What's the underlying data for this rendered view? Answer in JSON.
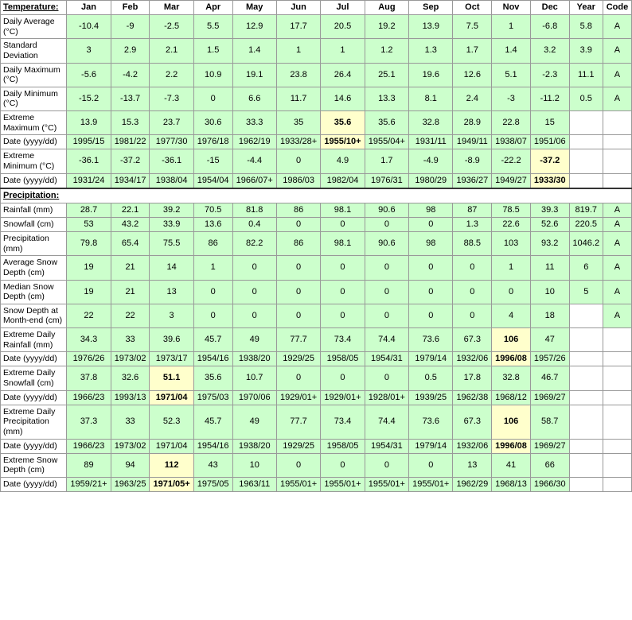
{
  "headers": {
    "label": "Temperature:",
    "months": [
      "Jan",
      "Feb",
      "Mar",
      "Apr",
      "May",
      "Jun",
      "Jul",
      "Aug",
      "Sep",
      "Oct",
      "Nov",
      "Dec",
      "Year",
      "Code"
    ]
  },
  "rows": [
    {
      "label": "Daily Average (°C)",
      "values": [
        "-10.4",
        "-9",
        "-2.5",
        "5.5",
        "12.9",
        "17.7",
        "20.5",
        "19.2",
        "13.9",
        "7.5",
        "1",
        "-6.8",
        "5.8",
        "A"
      ],
      "bg": [
        "green",
        "green",
        "green",
        "green",
        "green",
        "green",
        "green",
        "green",
        "green",
        "green",
        "green",
        "green",
        "green",
        "green"
      ]
    },
    {
      "label": "Standard Deviation",
      "values": [
        "3",
        "2.9",
        "2.1",
        "1.5",
        "1.4",
        "1",
        "1",
        "1.2",
        "1.3",
        "1.7",
        "1.4",
        "3.2",
        "3.9",
        "A"
      ],
      "bg": [
        "green",
        "green",
        "green",
        "green",
        "green",
        "green",
        "green",
        "green",
        "green",
        "green",
        "green",
        "green",
        "green",
        "green"
      ]
    },
    {
      "label": "Daily Maximum (°C)",
      "values": [
        "-5.6",
        "-4.2",
        "2.2",
        "10.9",
        "19.1",
        "23.8",
        "26.4",
        "25.1",
        "19.6",
        "12.6",
        "5.1",
        "-2.3",
        "11.1",
        "A"
      ],
      "bg": [
        "green",
        "green",
        "green",
        "green",
        "green",
        "green",
        "green",
        "green",
        "green",
        "green",
        "green",
        "green",
        "green",
        "green"
      ]
    },
    {
      "label": "Daily Minimum (°C)",
      "values": [
        "-15.2",
        "-13.7",
        "-7.3",
        "0",
        "6.6",
        "11.7",
        "14.6",
        "13.3",
        "8.1",
        "2.4",
        "-3",
        "-11.2",
        "0.5",
        "A"
      ],
      "bg": [
        "green",
        "green",
        "green",
        "green",
        "green",
        "green",
        "green",
        "green",
        "green",
        "green",
        "green",
        "green",
        "green",
        "green"
      ]
    },
    {
      "label": "Extreme Maximum (°C)",
      "values": [
        "13.9",
        "15.3",
        "23.7",
        "30.6",
        "33.3",
        "35",
        "35.6",
        "35.6",
        "32.8",
        "28.9",
        "22.8",
        "15",
        "",
        ""
      ],
      "bold": [
        false,
        false,
        false,
        false,
        false,
        false,
        true,
        false,
        false,
        false,
        false,
        false,
        false,
        false
      ],
      "bg": [
        "green",
        "green",
        "green",
        "green",
        "green",
        "green",
        "yellow",
        "green",
        "green",
        "green",
        "green",
        "green",
        "white",
        "white"
      ]
    },
    {
      "label": "Date (yyyy/dd)",
      "values": [
        "1995/15",
        "1981/22",
        "1977/30",
        "1976/18",
        "1962/19",
        "1933/28+",
        "1955/10+",
        "1955/04+",
        "1931/11",
        "1949/11",
        "1938/07",
        "1951/06",
        "",
        ""
      ],
      "bold": [
        false,
        false,
        false,
        false,
        false,
        false,
        true,
        false,
        false,
        false,
        false,
        false,
        false,
        false
      ],
      "bg": [
        "green",
        "green",
        "green",
        "green",
        "green",
        "green",
        "yellow",
        "green",
        "green",
        "green",
        "green",
        "green",
        "white",
        "white"
      ]
    },
    {
      "label": "Extreme Minimum (°C)",
      "values": [
        "-36.1",
        "-37.2",
        "-36.1",
        "-15",
        "-4.4",
        "0",
        "4.9",
        "1.7",
        "-4.9",
        "-8.9",
        "-22.2",
        "-37.2",
        "",
        ""
      ],
      "bold": [
        false,
        false,
        false,
        false,
        false,
        false,
        false,
        false,
        false,
        false,
        false,
        true,
        false,
        false
      ],
      "bg": [
        "green",
        "green",
        "green",
        "green",
        "green",
        "green",
        "green",
        "green",
        "green",
        "green",
        "green",
        "yellow",
        "white",
        "white"
      ]
    },
    {
      "label": "Date (yyyy/dd)",
      "values": [
        "1931/24",
        "1934/17",
        "1938/04",
        "1954/04",
        "1966/07+",
        "1986/03",
        "1982/04",
        "1976/31",
        "1980/29",
        "1936/27",
        "1949/27",
        "1933/30",
        "",
        ""
      ],
      "bold": [
        false,
        false,
        false,
        false,
        false,
        false,
        false,
        false,
        false,
        false,
        false,
        true,
        false,
        false
      ],
      "bg": [
        "green",
        "green",
        "green",
        "green",
        "green",
        "green",
        "green",
        "green",
        "green",
        "green",
        "green",
        "yellow",
        "white",
        "white"
      ]
    },
    {
      "section": "Precipitation:"
    },
    {
      "label": "Rainfall (mm)",
      "values": [
        "28.7",
        "22.1",
        "39.2",
        "70.5",
        "81.8",
        "86",
        "98.1",
        "90.6",
        "98",
        "87",
        "78.5",
        "39.3",
        "819.7",
        "A"
      ],
      "bg": [
        "green",
        "green",
        "green",
        "green",
        "green",
        "green",
        "green",
        "green",
        "green",
        "green",
        "green",
        "green",
        "green",
        "green"
      ]
    },
    {
      "label": "Snowfall (cm)",
      "values": [
        "53",
        "43.2",
        "33.9",
        "13.6",
        "0.4",
        "0",
        "0",
        "0",
        "0",
        "1.3",
        "22.6",
        "52.6",
        "220.5",
        "A"
      ],
      "bg": [
        "green",
        "green",
        "green",
        "green",
        "green",
        "green",
        "green",
        "green",
        "green",
        "green",
        "green",
        "green",
        "green",
        "green"
      ]
    },
    {
      "label": "Precipitation (mm)",
      "values": [
        "79.8",
        "65.4",
        "75.5",
        "86",
        "82.2",
        "86",
        "98.1",
        "90.6",
        "98",
        "88.5",
        "103",
        "93.2",
        "1046.2",
        "A"
      ],
      "bg": [
        "green",
        "green",
        "green",
        "green",
        "green",
        "green",
        "green",
        "green",
        "green",
        "green",
        "green",
        "green",
        "green",
        "green"
      ]
    },
    {
      "label": "Average Snow Depth (cm)",
      "values": [
        "19",
        "21",
        "14",
        "1",
        "0",
        "0",
        "0",
        "0",
        "0",
        "0",
        "1",
        "11",
        "6",
        "A"
      ],
      "bg": [
        "green",
        "green",
        "green",
        "green",
        "green",
        "green",
        "green",
        "green",
        "green",
        "green",
        "green",
        "green",
        "green",
        "green"
      ]
    },
    {
      "label": "Median Snow Depth (cm)",
      "values": [
        "19",
        "21",
        "13",
        "0",
        "0",
        "0",
        "0",
        "0",
        "0",
        "0",
        "0",
        "10",
        "5",
        "A"
      ],
      "bg": [
        "green",
        "green",
        "green",
        "green",
        "green",
        "green",
        "green",
        "green",
        "green",
        "green",
        "green",
        "green",
        "green",
        "green"
      ]
    },
    {
      "label": "Snow Depth at Month-end (cm)",
      "values": [
        "22",
        "22",
        "3",
        "0",
        "0",
        "0",
        "0",
        "0",
        "0",
        "0",
        "4",
        "18",
        "",
        "A"
      ],
      "bg": [
        "green",
        "green",
        "green",
        "green",
        "green",
        "green",
        "green",
        "green",
        "green",
        "green",
        "green",
        "green",
        "white",
        "green"
      ]
    },
    {
      "label": "Extreme Daily Rainfall (mm)",
      "values": [
        "34.3",
        "33",
        "39.6",
        "45.7",
        "49",
        "77.7",
        "73.4",
        "74.4",
        "73.6",
        "67.3",
        "106",
        "47",
        "",
        ""
      ],
      "bold": [
        false,
        false,
        false,
        false,
        false,
        false,
        false,
        false,
        false,
        false,
        true,
        false,
        false,
        false
      ],
      "bg": [
        "green",
        "green",
        "green",
        "green",
        "green",
        "green",
        "green",
        "green",
        "green",
        "green",
        "yellow",
        "green",
        "white",
        "white"
      ]
    },
    {
      "label": "Date (yyyy/dd)",
      "values": [
        "1976/26",
        "1973/02",
        "1973/17",
        "1954/16",
        "1938/20",
        "1929/25",
        "1958/05",
        "1954/31",
        "1979/14",
        "1932/06",
        "1996/08",
        "1957/26",
        "",
        ""
      ],
      "bold": [
        false,
        false,
        false,
        false,
        false,
        false,
        false,
        false,
        false,
        false,
        true,
        false,
        false,
        false
      ],
      "bg": [
        "green",
        "green",
        "green",
        "green",
        "green",
        "green",
        "green",
        "green",
        "green",
        "green",
        "yellow",
        "green",
        "white",
        "white"
      ]
    },
    {
      "label": "Extreme Daily Snowfall (cm)",
      "values": [
        "37.8",
        "32.6",
        "51.1",
        "35.6",
        "10.7",
        "0",
        "0",
        "0",
        "0.5",
        "17.8",
        "32.8",
        "46.7",
        "",
        ""
      ],
      "bold": [
        false,
        false,
        true,
        false,
        false,
        false,
        false,
        false,
        false,
        false,
        false,
        false,
        false,
        false
      ],
      "bg": [
        "green",
        "green",
        "yellow",
        "green",
        "green",
        "green",
        "green",
        "green",
        "green",
        "green",
        "green",
        "green",
        "white",
        "white"
      ]
    },
    {
      "label": "Date (yyyy/dd)",
      "values": [
        "1966/23",
        "1993/13",
        "1971/04",
        "1975/03",
        "1970/06",
        "1929/01+",
        "1929/01+",
        "1928/01+",
        "1939/25",
        "1962/38",
        "1968/12",
        "1969/27",
        "",
        ""
      ],
      "bold": [
        false,
        false,
        true,
        false,
        false,
        false,
        false,
        false,
        false,
        false,
        false,
        false,
        false,
        false
      ],
      "bg": [
        "green",
        "green",
        "yellow",
        "green",
        "green",
        "green",
        "green",
        "green",
        "green",
        "green",
        "green",
        "green",
        "white",
        "white"
      ]
    },
    {
      "label": "Extreme Daily Precipitation (mm)",
      "values": [
        "37.3",
        "33",
        "52.3",
        "45.7",
        "49",
        "77.7",
        "73.4",
        "74.4",
        "73.6",
        "67.3",
        "106",
        "58.7",
        "",
        ""
      ],
      "bold": [
        false,
        false,
        false,
        false,
        false,
        false,
        false,
        false,
        false,
        false,
        true,
        false,
        false,
        false
      ],
      "bg": [
        "green",
        "green",
        "green",
        "green",
        "green",
        "green",
        "green",
        "green",
        "green",
        "green",
        "yellow",
        "green",
        "white",
        "white"
      ]
    },
    {
      "label": "Date (yyyy/dd)",
      "values": [
        "1966/23",
        "1973/02",
        "1971/04",
        "1954/16",
        "1938/20",
        "1929/25",
        "1958/05",
        "1954/31",
        "1979/14",
        "1932/06",
        "1996/08",
        "1969/27",
        "",
        ""
      ],
      "bold": [
        false,
        false,
        false,
        false,
        false,
        false,
        false,
        false,
        false,
        false,
        true,
        false,
        false,
        false
      ],
      "bg": [
        "green",
        "green",
        "green",
        "green",
        "green",
        "green",
        "green",
        "green",
        "green",
        "green",
        "yellow",
        "green",
        "white",
        "white"
      ]
    },
    {
      "label": "Extreme Snow Depth (cm)",
      "values": [
        "89",
        "94",
        "112",
        "43",
        "10",
        "0",
        "0",
        "0",
        "0",
        "13",
        "41",
        "66",
        "",
        ""
      ],
      "bold": [
        false,
        false,
        true,
        false,
        false,
        false,
        false,
        false,
        false,
        false,
        false,
        false,
        false,
        false
      ],
      "bg": [
        "green",
        "green",
        "yellow",
        "green",
        "green",
        "green",
        "green",
        "green",
        "green",
        "green",
        "green",
        "green",
        "white",
        "white"
      ]
    },
    {
      "label": "Date (yyyy/dd)",
      "values": [
        "1959/21+",
        "1963/25",
        "1971/05+",
        "1975/05",
        "1963/11",
        "1955/01+",
        "1955/01+",
        "1955/01+",
        "1955/01+",
        "1962/29",
        "1968/13",
        "1966/30",
        "",
        ""
      ],
      "bold": [
        false,
        false,
        true,
        false,
        false,
        false,
        false,
        false,
        false,
        false,
        false,
        false,
        false,
        false
      ],
      "bg": [
        "green",
        "green",
        "yellow",
        "green",
        "green",
        "green",
        "green",
        "green",
        "green",
        "green",
        "green",
        "green",
        "white",
        "white"
      ]
    }
  ]
}
